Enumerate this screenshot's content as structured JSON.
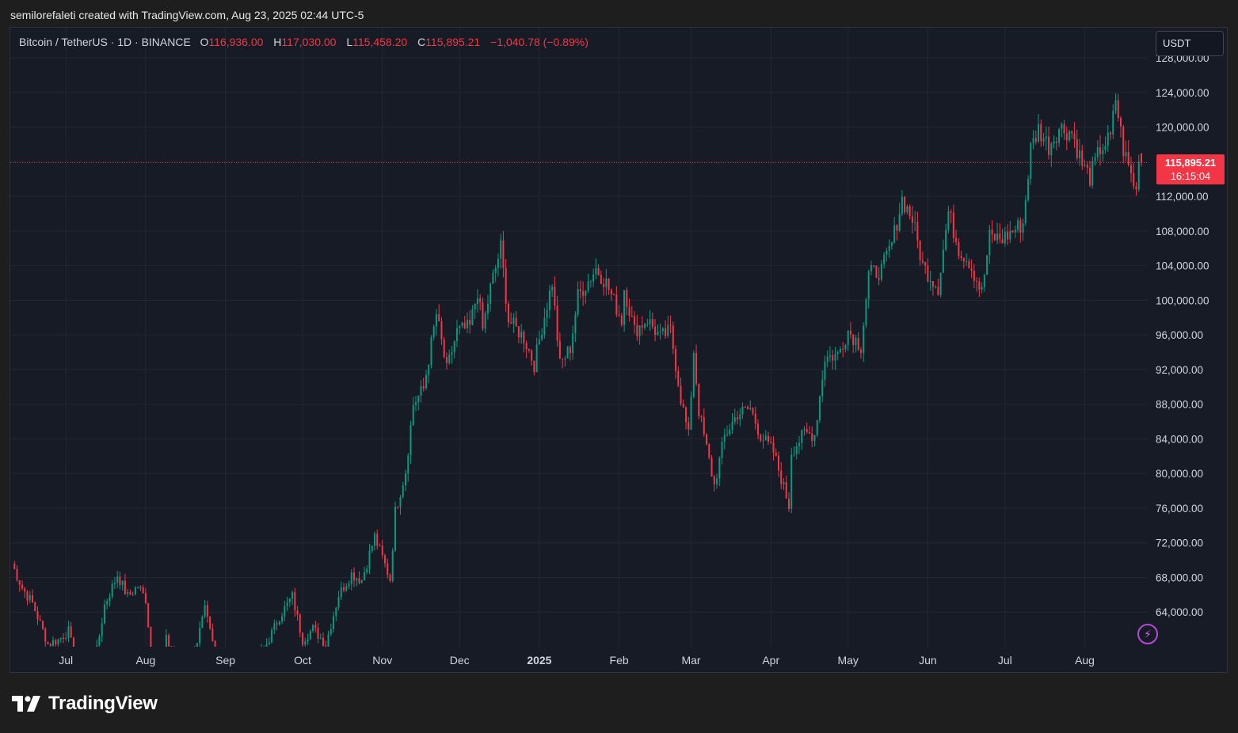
{
  "caption": "semilorefaleti created with TradingView.com, Aug 23, 2025 02:44 UTC-5",
  "legend": {
    "symbol": "Bitcoin / TetherUS · 1D · BINANCE",
    "open_label": "O",
    "open": "116,936.00",
    "high_label": "H",
    "high": "117,030.00",
    "low_label": "L",
    "low": "115,458.20",
    "close_label": "C",
    "close": "115,895.21",
    "change": "−1,040.78 (−0.89%)"
  },
  "currency_button": "USDT",
  "price_tag": {
    "price": "115,895.21",
    "countdown": "16:15:04"
  },
  "logo": {
    "text": "TradingView"
  },
  "colors": {
    "up": "#089981",
    "down": "#f23645",
    "background": "#171b26",
    "grid": "#232733"
  },
  "icons": [
    "bolt-icon",
    "tradingview-logo-icon"
  ],
  "chart_data": {
    "type": "candlestick",
    "symbol": "Bitcoin / TetherUS",
    "interval": "1D",
    "exchange": "BINANCE",
    "ylim": [
      60000,
      128000
    ],
    "y_ticks": [
      {
        "value": 64000,
        "label": "64,000.00"
      },
      {
        "value": 68000,
        "label": "68,000.00"
      },
      {
        "value": 72000,
        "label": "72,000.00"
      },
      {
        "value": 76000,
        "label": "76,000.00"
      },
      {
        "value": 80000,
        "label": "80,000.00"
      },
      {
        "value": 84000,
        "label": "84,000.00"
      },
      {
        "value": 88000,
        "label": "88,000.00"
      },
      {
        "value": 92000,
        "label": "92,000.00"
      },
      {
        "value": 96000,
        "label": "96,000.00"
      },
      {
        "value": 100000,
        "label": "100,000.00"
      },
      {
        "value": 104000,
        "label": "104,000.00"
      },
      {
        "value": 108000,
        "label": "108,000.00"
      },
      {
        "value": 112000,
        "label": "112,000.00"
      },
      {
        "value": 116000,
        "label": "116,000.00"
      },
      {
        "value": 120000,
        "label": "120,000.00"
      },
      {
        "value": 124000,
        "label": "124,000.00"
      },
      {
        "value": 128000,
        "label": "128,000.00"
      }
    ],
    "x_ticks": [
      {
        "date": "2024-07-01",
        "label": "Jul",
        "bold": false
      },
      {
        "date": "2024-08-01",
        "label": "Aug",
        "bold": false
      },
      {
        "date": "2024-09-01",
        "label": "Sep",
        "bold": false
      },
      {
        "date": "2024-10-01",
        "label": "Oct",
        "bold": false
      },
      {
        "date": "2024-11-01",
        "label": "Nov",
        "bold": false
      },
      {
        "date": "2024-12-01",
        "label": "Dec",
        "bold": false
      },
      {
        "date": "2025-01-01",
        "label": "2025",
        "bold": true
      },
      {
        "date": "2025-02-01",
        "label": "Feb",
        "bold": false
      },
      {
        "date": "2025-03-01",
        "label": "Mar",
        "bold": false
      },
      {
        "date": "2025-04-01",
        "label": "Apr",
        "bold": false
      },
      {
        "date": "2025-05-01",
        "label": "May",
        "bold": false
      },
      {
        "date": "2025-06-01",
        "label": "Jun",
        "bold": false
      },
      {
        "date": "2025-07-01",
        "label": "Jul",
        "bold": false
      },
      {
        "date": "2025-08-01",
        "label": "Aug",
        "bold": false
      }
    ],
    "x_range": [
      "2024-06-10",
      "2025-08-23"
    ],
    "last_price": 115895.21,
    "close_path": [
      [
        "2024-06-10",
        69600
      ],
      [
        "2024-06-14",
        66800
      ],
      [
        "2024-06-18",
        65000
      ],
      [
        "2024-06-24",
        60300
      ],
      [
        "2024-06-28",
        60800
      ],
      [
        "2024-07-02",
        61800
      ],
      [
        "2024-07-06",
        56500
      ],
      [
        "2024-07-12",
        57800
      ],
      [
        "2024-07-16",
        64800
      ],
      [
        "2024-07-21",
        68300
      ],
      [
        "2024-07-25",
        65800
      ],
      [
        "2024-07-29",
        67000
      ],
      [
        "2024-08-01",
        65500
      ],
      [
        "2024-08-05",
        54000
      ],
      [
        "2024-08-09",
        60800
      ],
      [
        "2024-08-15",
        57600
      ],
      [
        "2024-08-20",
        59500
      ],
      [
        "2024-08-24",
        64200
      ],
      [
        "2024-08-28",
        59100
      ],
      [
        "2024-09-02",
        58000
      ],
      [
        "2024-09-06",
        53900
      ],
      [
        "2024-09-12",
        58100
      ],
      [
        "2024-09-17",
        60300
      ],
      [
        "2024-09-22",
        63500
      ],
      [
        "2024-09-27",
        65800
      ],
      [
        "2024-10-01",
        60800
      ],
      [
        "2024-10-05",
        62100
      ],
      [
        "2024-10-10",
        60300
      ],
      [
        "2024-10-15",
        66000
      ],
      [
        "2024-10-20",
        68400
      ],
      [
        "2024-10-24",
        67700
      ],
      [
        "2024-10-29",
        72700
      ],
      [
        "2024-11-04",
        67800
      ],
      [
        "2024-11-06",
        75600
      ],
      [
        "2024-11-10",
        80300
      ],
      [
        "2024-11-13",
        88000
      ],
      [
        "2024-11-17",
        89800
      ],
      [
        "2024-11-22",
        98400
      ],
      [
        "2024-11-26",
        91900
      ],
      [
        "2024-11-30",
        96400
      ],
      [
        "2024-12-05",
        96900
      ],
      [
        "2024-12-08",
        101100
      ],
      [
        "2024-12-10",
        96600
      ],
      [
        "2024-12-13",
        101400
      ],
      [
        "2024-12-17",
        106100
      ],
      [
        "2024-12-20",
        97700
      ],
      [
        "2024-12-26",
        95700
      ],
      [
        "2024-12-30",
        92600
      ],
      [
        "2025-01-02",
        96900
      ],
      [
        "2025-01-06",
        102100
      ],
      [
        "2025-01-09",
        92500
      ],
      [
        "2025-01-13",
        94500
      ],
      [
        "2025-01-16",
        100500
      ],
      [
        "2025-01-20",
        102200
      ],
      [
        "2025-01-23",
        103700
      ],
      [
        "2025-01-27",
        102000
      ],
      [
        "2025-02-02",
        97700
      ],
      [
        "2025-02-03",
        101400
      ],
      [
        "2025-02-07",
        96500
      ],
      [
        "2025-02-12",
        97800
      ],
      [
        "2025-02-17",
        95700
      ],
      [
        "2025-02-21",
        96500
      ],
      [
        "2025-02-25",
        88700
      ],
      [
        "2025-02-28",
        84300
      ],
      [
        "2025-03-02",
        94200
      ],
      [
        "2025-03-04",
        87200
      ],
      [
        "2025-03-10",
        78600
      ],
      [
        "2025-03-14",
        84300
      ],
      [
        "2025-03-19",
        86900
      ],
      [
        "2025-03-24",
        87500
      ],
      [
        "2025-03-28",
        84400
      ],
      [
        "2025-04-02",
        82500
      ],
      [
        "2025-04-06",
        78400
      ],
      [
        "2025-04-08",
        76300
      ],
      [
        "2025-04-09",
        82600
      ],
      [
        "2025-04-14",
        84600
      ],
      [
        "2025-04-18",
        84500
      ],
      [
        "2025-04-22",
        93400
      ],
      [
        "2025-04-27",
        93700
      ],
      [
        "2025-05-01",
        96500
      ],
      [
        "2025-05-06",
        94700
      ],
      [
        "2025-05-09",
        103000
      ],
      [
        "2025-05-14",
        103500
      ],
      [
        "2025-05-18",
        106500
      ],
      [
        "2025-05-22",
        111700
      ],
      [
        "2025-05-26",
        109400
      ],
      [
        "2025-05-30",
        104000
      ],
      [
        "2025-06-05",
        101500
      ],
      [
        "2025-06-09",
        110200
      ],
      [
        "2025-06-13",
        106000
      ],
      [
        "2025-06-17",
        104500
      ],
      [
        "2025-06-22",
        100900
      ],
      [
        "2025-06-25",
        107300
      ],
      [
        "2025-06-30",
        107100
      ],
      [
        "2025-07-04",
        108000
      ],
      [
        "2025-07-08",
        108900
      ],
      [
        "2025-07-11",
        117500
      ],
      [
        "2025-07-14",
        119800
      ],
      [
        "2025-07-18",
        117800
      ],
      [
        "2025-07-22",
        119900
      ],
      [
        "2025-07-27",
        119400
      ],
      [
        "2025-07-31",
        115700
      ],
      [
        "2025-08-03",
        114200
      ],
      [
        "2025-08-07",
        117500
      ],
      [
        "2025-08-11",
        118700
      ],
      [
        "2025-08-13",
        123300
      ],
      [
        "2025-08-16",
        117400
      ],
      [
        "2025-08-20",
        113500
      ],
      [
        "2025-08-21",
        112500
      ],
      [
        "2025-08-22",
        116936
      ],
      [
        "2025-08-23",
        115895
      ]
    ],
    "last_candle": {
      "date": "2025-08-23",
      "open": 116936.0,
      "high": 117030.0,
      "low": 115458.2,
      "close": 115895.21
    }
  }
}
